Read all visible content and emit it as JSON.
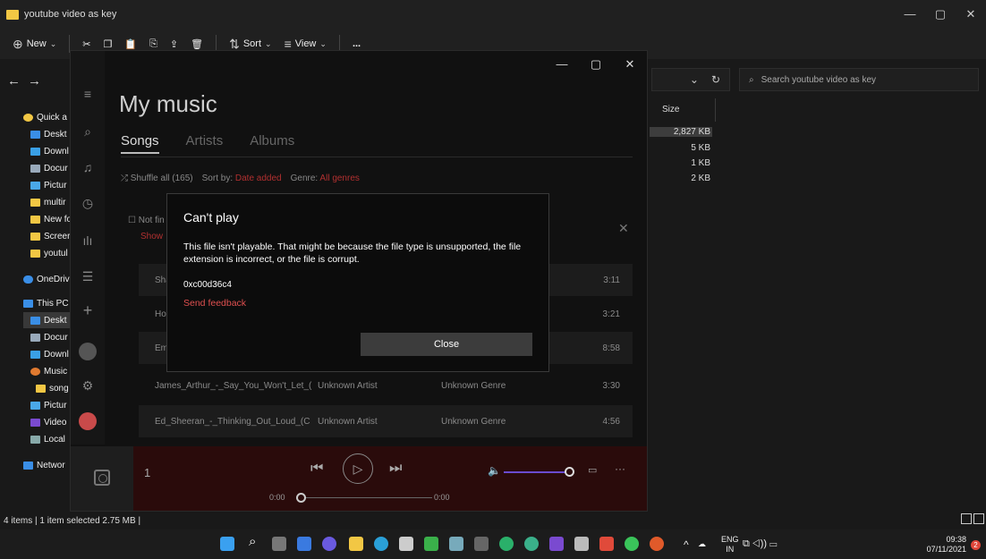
{
  "explorer": {
    "title": "youtube video as key",
    "toolbar": {
      "new_label": "New",
      "sort_label": "Sort",
      "view_label": "View",
      "more_label": "..."
    },
    "search_placeholder": "Search youtube video as key",
    "sidebar": {
      "items": [
        "Quick a",
        "Deskt",
        "Downl",
        "Docur",
        "Pictur",
        "multir",
        "New fo",
        "Screer",
        "youtul",
        "OneDriv",
        "This PC",
        "Deskt",
        "Docur",
        "Downl",
        "Music",
        "song",
        "Pictur",
        "Video",
        "Local",
        "Networ"
      ]
    },
    "size_header": "Size",
    "sizes": [
      "2,827 KB",
      "5 KB",
      "1 KB",
      "2 KB"
    ],
    "status": "4 items  |  1 item selected  2.75 MB  |"
  },
  "music": {
    "title": "My music",
    "tabs": [
      "Songs",
      "Artists",
      "Albums"
    ],
    "shuffle_label": "Shuffle all (165)",
    "sort_label": "Sort by:",
    "sort_value": "Date added",
    "genre_label": "Genre:",
    "genre_value": "All genres",
    "notfind_text": "Not fin",
    "notfind_link": "Show",
    "songs": [
      {
        "title": "Sha",
        "artist": "",
        "genre": "",
        "duration": "3:11"
      },
      {
        "title": "Ho",
        "artist": "",
        "genre": "",
        "duration": "3:21"
      },
      {
        "title": "Em",
        "artist": "",
        "genre": "",
        "duration": "8:58"
      },
      {
        "title": "James_Arthur_-_Say_You_Won't_Let_(",
        "artist": "Unknown Artist",
        "genre": "Unknown Genre",
        "duration": "3:30"
      },
      {
        "title": "Ed_Sheeran_-_Thinking_Out_Loud_(C",
        "artist": "Unknown Artist",
        "genre": "Unknown Genre",
        "duration": "4:56"
      }
    ],
    "player": {
      "track_number": "1",
      "time_start": "0:00",
      "time_end": "0:00"
    }
  },
  "dialog": {
    "title": "Can't play",
    "message": "This file isn't playable. That might be because the file type is unsupported, the file extension is incorrect, or the file is corrupt.",
    "code": "0xc00d36c4",
    "feedback_link": "Send feedback",
    "close_label": "Close"
  },
  "taskbar": {
    "lang_top": "ENG",
    "lang_bottom": "IN",
    "time": "09:38",
    "date": "07/11/2021",
    "notification_count": "2"
  }
}
